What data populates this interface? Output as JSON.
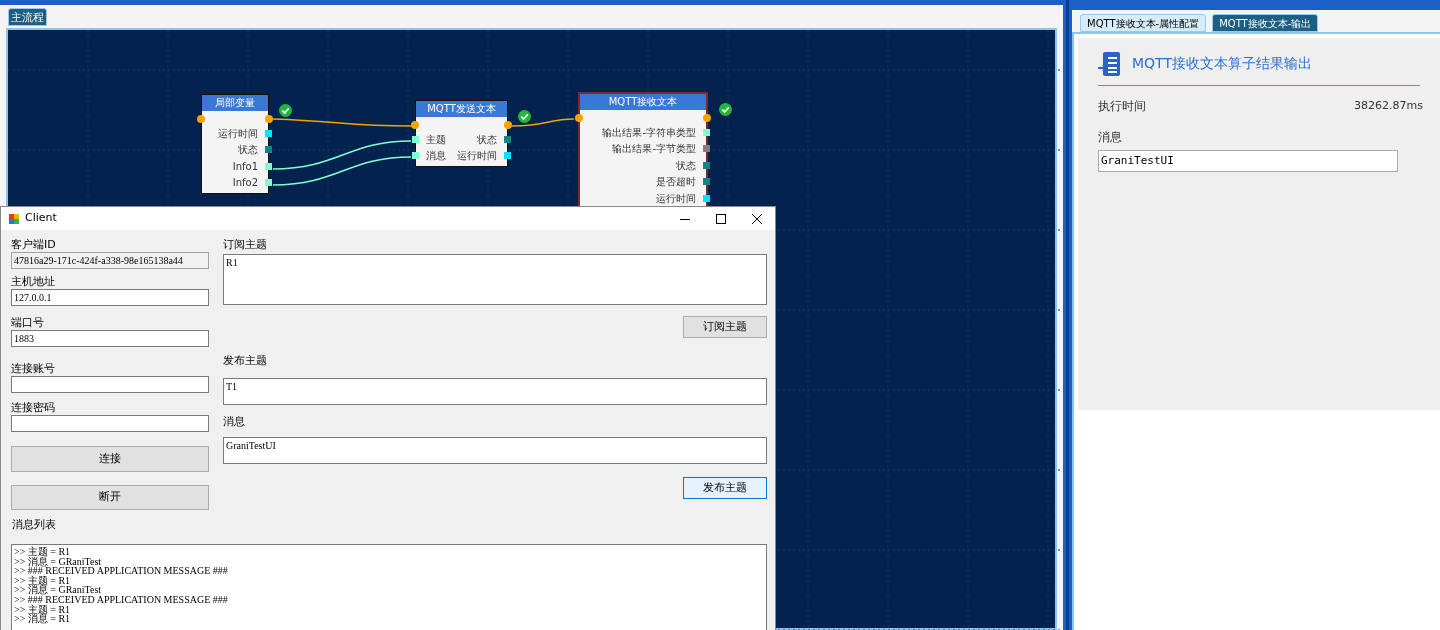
{
  "flow_tabs": [
    {
      "label": "主流程",
      "selected": true
    }
  ],
  "nodes": [
    {
      "title": "局部变量",
      "selected": false,
      "ok": true,
      "outputs": [
        {
          "label": "运行时间",
          "color": "#00e5ff"
        },
        {
          "label": "状态",
          "color": "#138585"
        },
        {
          "label": "Info1",
          "color": "#7fffd4"
        },
        {
          "label": "Info2",
          "color": "#7fffd4"
        }
      ]
    },
    {
      "title": "MQTT发送文本",
      "selected": false,
      "ok": true,
      "inputs": [
        {
          "label": "主题",
          "color": "#7fffd4"
        },
        {
          "label": "消息",
          "color": "#7fffd4"
        }
      ],
      "outputs": [
        {
          "label": "状态",
          "color": "#138585"
        },
        {
          "label": "运行时间",
          "color": "#00e5ff"
        }
      ]
    },
    {
      "title": "MQTT接收文本",
      "selected": true,
      "ok": true,
      "outputs": [
        {
          "label": "输出结果-字符串类型",
          "color": "#7fffd4"
        },
        {
          "label": "输出结果-字节类型",
          "color": "#808080"
        },
        {
          "label": "状态",
          "color": "#138585"
        },
        {
          "label": "是否超时",
          "color": "#138585"
        },
        {
          "label": "运行时间",
          "color": "#00e5ff"
        }
      ]
    }
  ],
  "client_window": {
    "title": "Client",
    "left_fields": [
      {
        "label": "客户端ID",
        "value": "47816a29-171c-424f-a338-98e165138a44",
        "disabled": true
      },
      {
        "label": "主机地址",
        "value": "127.0.0.1",
        "disabled": false
      },
      {
        "label": "端口号",
        "value": "1883",
        "disabled": false
      },
      {
        "label": "连接账号",
        "disabled": false
      },
      {
        "label": "连接密码",
        "disabled": false
      }
    ],
    "connect_button": "连接",
    "disconnect_button": "断开",
    "subscribe_label": "订阅主题",
    "subscribe_value": "R1",
    "subscribe_button": "订阅主题",
    "publish_label": "发布主题",
    "publish_value": "T1",
    "message_label": "消息",
    "message_value": "GraniTestUI",
    "publish_button": "发布主题",
    "log_label": "消息列表",
    "log_lines": [
      ">> 主题 = R1",
      ">> 消息 = GRaniTest",
      ">> ### RECEIVED APPLICATION MESSAGE ###",
      ">> 主题 = R1",
      ">> 消息 = GRaniTest",
      ">> ### RECEIVED APPLICATION MESSAGE ###",
      ">> 主题 = R1",
      ">> 消息 = R1"
    ]
  },
  "right_panel": {
    "tabs": [
      {
        "label": "MQTT接收文本-属性配置",
        "selected": false
      },
      {
        "label": "MQTT接收文本-输出",
        "selected": true
      }
    ],
    "title": "MQTT接收文本算子结果输出",
    "exec_label": "执行时间",
    "exec_value": "38262.87ms",
    "message_label": "消息",
    "message_value": "GraniTestUI"
  }
}
